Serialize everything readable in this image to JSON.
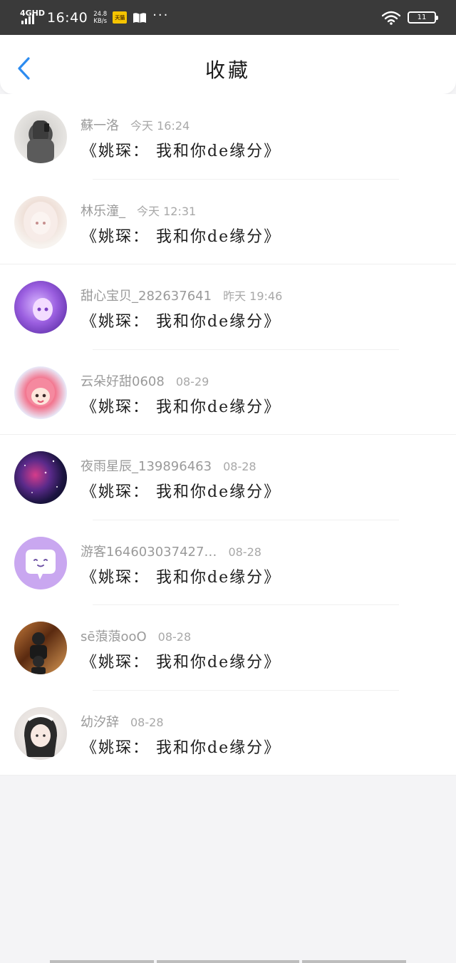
{
  "status_bar": {
    "network": "4GHD",
    "time": "16:40",
    "speed_value": "24.8",
    "speed_unit": "KB/s",
    "app_badge": "天猫",
    "overflow": "···",
    "battery_text": "11"
  },
  "header": {
    "title": "收藏",
    "back_icon": "chevron-left-icon"
  },
  "colors": {
    "accent": "#2d8cf0",
    "status_bar_bg": "#3a3a3a",
    "page_bg": "#f4f4f6"
  },
  "favorites": [
    {
      "user": "蘇一洛",
      "time": "今天 16:24",
      "title": "《姚琛： 我和你de缘分》"
    },
    {
      "user": "林乐潼_",
      "time": "今天 12:31",
      "title": "《姚琛： 我和你de缘分》"
    },
    {
      "user": "甜心宝贝_282637641",
      "time": "昨天 19:46",
      "title": "《姚琛： 我和你de缘分》"
    },
    {
      "user": "云朵好甜0608",
      "time": "08-29",
      "title": "《姚琛： 我和你de缘分》"
    },
    {
      "user": "夜雨星辰_139896463",
      "time": "08-28",
      "title": "《姚琛： 我和你de缘分》"
    },
    {
      "user": "游客164603037427…",
      "time": "08-28",
      "title": "《姚琛： 我和你de缘分》"
    },
    {
      "user": "sē蒗蒗ooO",
      "time": "08-28",
      "title": "《姚琛： 我和你de缘分》"
    },
    {
      "user": "幼汐辞",
      "time": "08-28",
      "title": "《姚琛： 我和你de缘分》"
    }
  ]
}
